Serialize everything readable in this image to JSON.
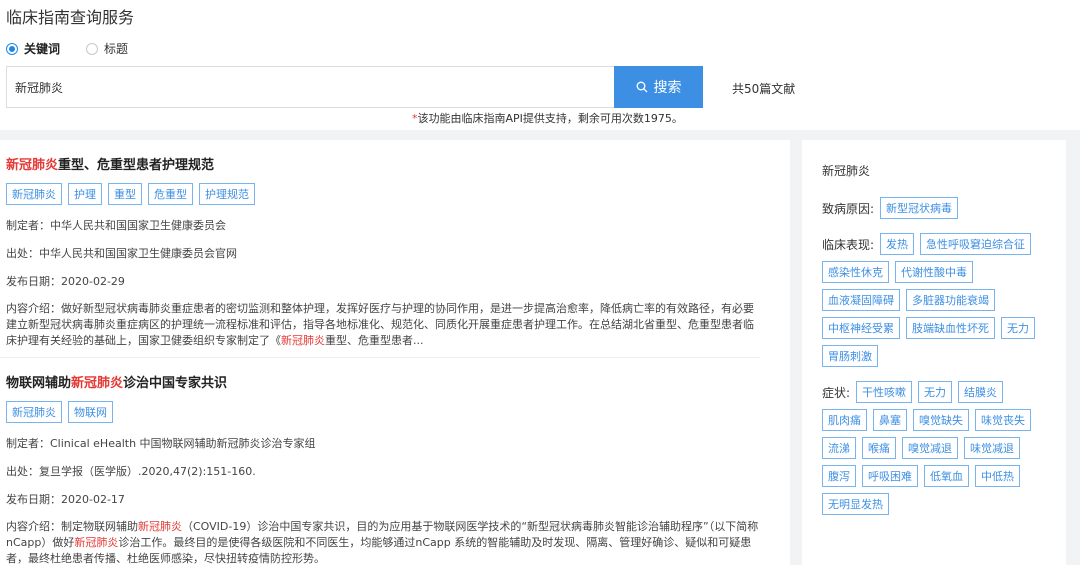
{
  "header": {
    "title": "临床指南查询服务"
  },
  "search": {
    "mode_options": [
      {
        "label": "关键词",
        "checked": true
      },
      {
        "label": "标题",
        "checked": false
      }
    ],
    "query": "新冠肺炎",
    "button_label": "搜索",
    "result_count": "共50篇文献",
    "api_note_star": "*",
    "api_note": "该功能由临床指南API提供支持，剩余可用次数1975。"
  },
  "results": [
    {
      "title_hl": "新冠肺炎",
      "title_rest": "重型、危重型患者护理规范",
      "tags": [
        "新冠肺炎",
        "护理",
        "重型",
        "危重型",
        "护理规范"
      ],
      "author": "制定者：中华人民共和国国家卫生健康委员会",
      "source": "出处：中华人民共和国国家卫生健康委员会官网",
      "date": "发布日期：2020-02-29",
      "desc_a": "内容介绍：做好新型冠状病毒肺炎重症患者的密切监测和整体护理，发挥好医疗与护理的协同作用，是进一步提高治愈率，降低病亡率的有效路径，有必要建立新型冠状病毒肺炎重症病区的护理统一流程标准和评估，指导各地标准化、规范化、同质化开展重症患者护理工作。在总结湖北省重型、危重型患者临床护理有关经验的基础上，国家卫健委组织专家制定了《",
      "desc_hl": "新冠肺炎",
      "desc_b": "重型、危重型患者..."
    },
    {
      "title_pre": "物联网辅助",
      "title_hl": "新冠肺炎",
      "title_rest": "诊治中国专家共识",
      "tags": [
        "新冠肺炎",
        "物联网"
      ],
      "author": "制定者：Clinical eHealth 中国物联网辅助新冠肺炎诊治专家组",
      "source": "出处：复旦学报（医学版）.2020,47(2):151-160.",
      "date": "发布日期：2020-02-17",
      "desc_a": "内容介绍：制定物联网辅助",
      "desc_hl": "新冠肺炎",
      "desc_b": "（COVID-19）诊治中国专家共识，目的为应用基于物联网医学技术的“新型冠状病毒肺炎智能诊治辅助程序”（以下简称nCapp）做好",
      "desc_hl2": "新冠肺炎",
      "desc_c": "诊治工作。最终目的是使得各级医院和不同医生，均能够通过nCapp 系统的智能辅助及时发现、隔离、管理好确诊、疑似和可疑患者，最终杜绝患者传播、杜绝医师感染，尽快扭转疫情防控形势。"
    }
  ],
  "knowledge": {
    "title": "新冠肺炎",
    "cause_label": "致病原因:",
    "cause_tags": [
      "新型冠状病毒"
    ],
    "clinical_label": "临床表现:",
    "clinical_tags": [
      "发热",
      "急性呼吸窘迫综合征",
      "感染性休克",
      "代谢性酸中毒",
      "血液凝固障碍",
      "多脏器功能衰竭",
      "中枢神经受累",
      "肢端缺血性坏死",
      "无力",
      "胃肠刺激"
    ],
    "symptom_label": "症状:",
    "symptom_tags": [
      "干性咳嗽",
      "无力",
      "结膜炎",
      "肌肉痛",
      "鼻塞",
      "嗅觉缺失",
      "味觉丧失",
      "流涕",
      "喉痛",
      "嗅觉减退",
      "味觉减退",
      "腹泻",
      "呼吸困难",
      "低氧血",
      "中低热",
      "无明显发热"
    ]
  },
  "colors": {
    "accent": "#3d8fe3",
    "highlight": "#e53935"
  }
}
